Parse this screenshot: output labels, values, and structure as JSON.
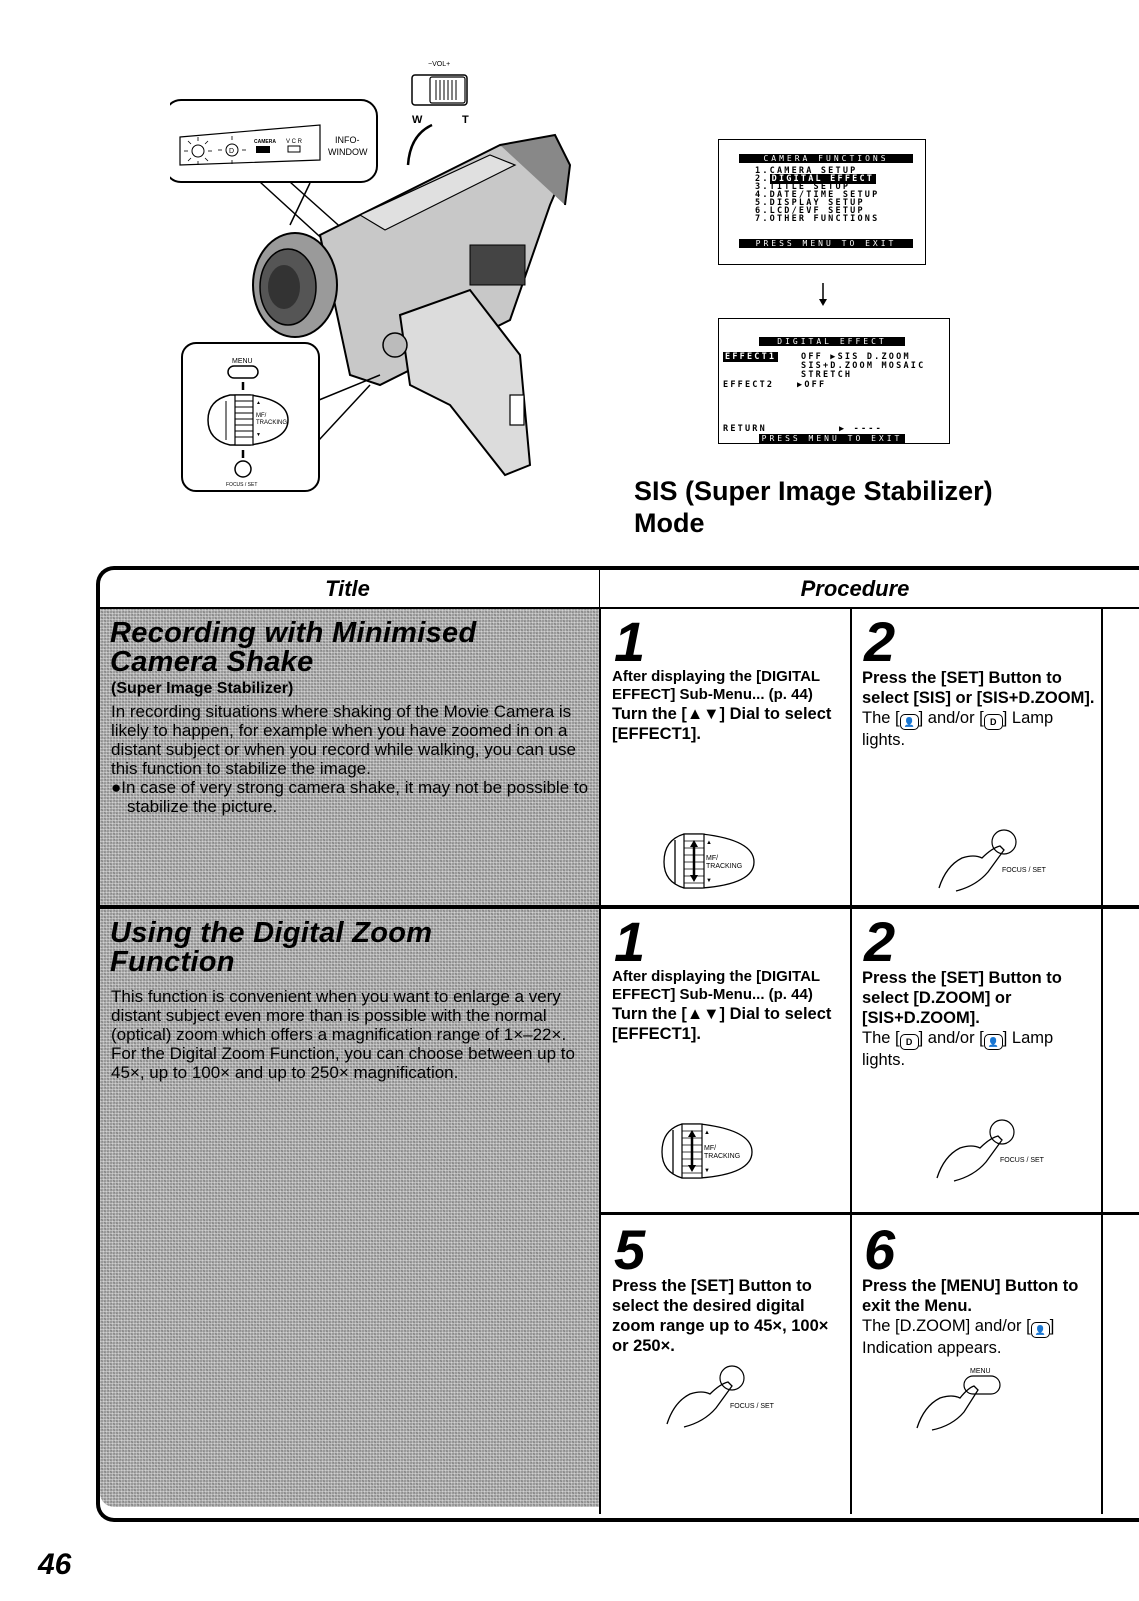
{
  "illustration": {
    "vol_label": "−VOL+",
    "zoom_w": "W",
    "zoom_t": "T",
    "info_window": {
      "label_line1": "INFO-",
      "label_line2": "WINDOW",
      "lamps": [
        "SIS",
        "D",
        "CAMERA",
        "VCR"
      ]
    },
    "control_panel": {
      "menu_label": "MENU",
      "dial_label_line1": "MF/",
      "dial_label_line2": "TRACKING",
      "focus_set_label": "FOCUS / SET"
    }
  },
  "lcd_camera_functions": {
    "title": "CAMERA FUNCTIONS",
    "items": [
      {
        "no": "1.",
        "label": "CAMERA SETUP",
        "selected": false
      },
      {
        "no": "2.",
        "label": "DIGITAL EFFECT",
        "selected": true
      },
      {
        "no": "3.",
        "label": "TITLE SETUP",
        "selected": false
      },
      {
        "no": "4.",
        "label": "DATE/TIME SETUP",
        "selected": false
      },
      {
        "no": "5.",
        "label": "DISPLAY SETUP",
        "selected": false
      },
      {
        "no": "6.",
        "label": "LCD/EVF SETUP",
        "selected": false
      },
      {
        "no": "7.",
        "label": "OTHER FUNCTIONS",
        "selected": false
      }
    ],
    "footer": "PRESS MENU TO EXIT"
  },
  "lcd_digital_effect": {
    "title": "DIGITAL EFFECT",
    "effect1_label": "EFFECT1",
    "effect1_opts_line1": "OFF  ▶SIS   D.ZOOM",
    "effect1_opts_line2": "SIS+D.ZOOM  MOSAIC",
    "effect1_opts_line3": "STRETCH",
    "effect2_label": "EFFECT2",
    "effect2_value": "▶OFF",
    "return_label": "RETURN",
    "return_value": "▶ ----",
    "footer": "PRESS MENU TO EXIT"
  },
  "heading": {
    "line1": "SIS (Super Image Stabilizer)",
    "line2": "Mode"
  },
  "table": {
    "header_title": "Title",
    "header_procedure": "Procedure",
    "rows": [
      {
        "title": "Recording with Minimised Camera Shake",
        "title_line1": "Recording with Minimised",
        "title_line2": "Camera Shake",
        "subtitle": "(Super Image Stabilizer)",
        "body": "In recording situations where shaking of the Movie Camera is likely to happen, for example when you have zoomed in on a distant subject or when you record while walking, you can use this function to stabilize the image.",
        "bullet": "●In case of very strong camera shake, it may not be possible to stabilize the picture.",
        "steps": [
          {
            "number": "1",
            "bold_text": "After displaying the [DIGITAL EFFECT] Sub-Menu... (p. 44)",
            "bold_text2": "Turn the [▲▼] Dial to select [EFFECT1].",
            "figure": "dial",
            "figure_label_1": "MF/",
            "figure_label_2": "TRACKING"
          },
          {
            "number": "2",
            "bold_text": "Press the [SET] Button to select [SIS] or [SIS+D.ZOOM].",
            "normal_pre": "The [",
            "lamp_a": "SIS",
            "normal_mid": "] and/or [",
            "lamp_b": "D",
            "normal_post": "] Lamp lights.",
            "figure": "focus-set-button",
            "figure_label": "FOCUS / SET"
          }
        ]
      },
      {
        "title": "Using the Digital Zoom Function",
        "title_line1": "Using the Digital Zoom",
        "title_line2": "Function",
        "body": "This function is convenient when you want to enlarge a very distant subject even more than is possible with the normal (optical) zoom which offers a magnification range of 1×–22×. For the Digital Zoom Function, you can choose between up to 45×, up to 100× and up to 250× magnification.",
        "steps": [
          {
            "number": "1",
            "bold_text": "After displaying the [DIGITAL EFFECT] Sub-Menu... (p. 44)",
            "bold_text2": "Turn the [▲▼] Dial to select [EFFECT1].",
            "figure": "dial",
            "figure_label_1": "MF/",
            "figure_label_2": "TRACKING"
          },
          {
            "number": "2",
            "bold_text": "Press the [SET] Button to select [D.ZOOM] or [SIS+D.ZOOM].",
            "normal_pre": "The [",
            "lamp_a": "D",
            "normal_mid": "] and/or [",
            "lamp_b": "SIS",
            "normal_post": "] Lamp lights.",
            "figure": "focus-set-button",
            "figure_label": "FOCUS / SET"
          },
          {
            "number": "5",
            "bold_text": "Press the [SET] Button to select the desired digital zoom range up to 45×, 100× or 250×.",
            "figure": "focus-set-button",
            "figure_label": "FOCUS / SET"
          },
          {
            "number": "6",
            "bold_text": "Press the [MENU] Button to exit the Menu.",
            "normal_pre": "The [D.ZOOM] and/or [",
            "lamp_a": "SIS",
            "normal_post": "] Indication appears.",
            "figure": "menu-button",
            "figure_label": "MENU"
          }
        ]
      }
    ]
  },
  "page_number": "46"
}
